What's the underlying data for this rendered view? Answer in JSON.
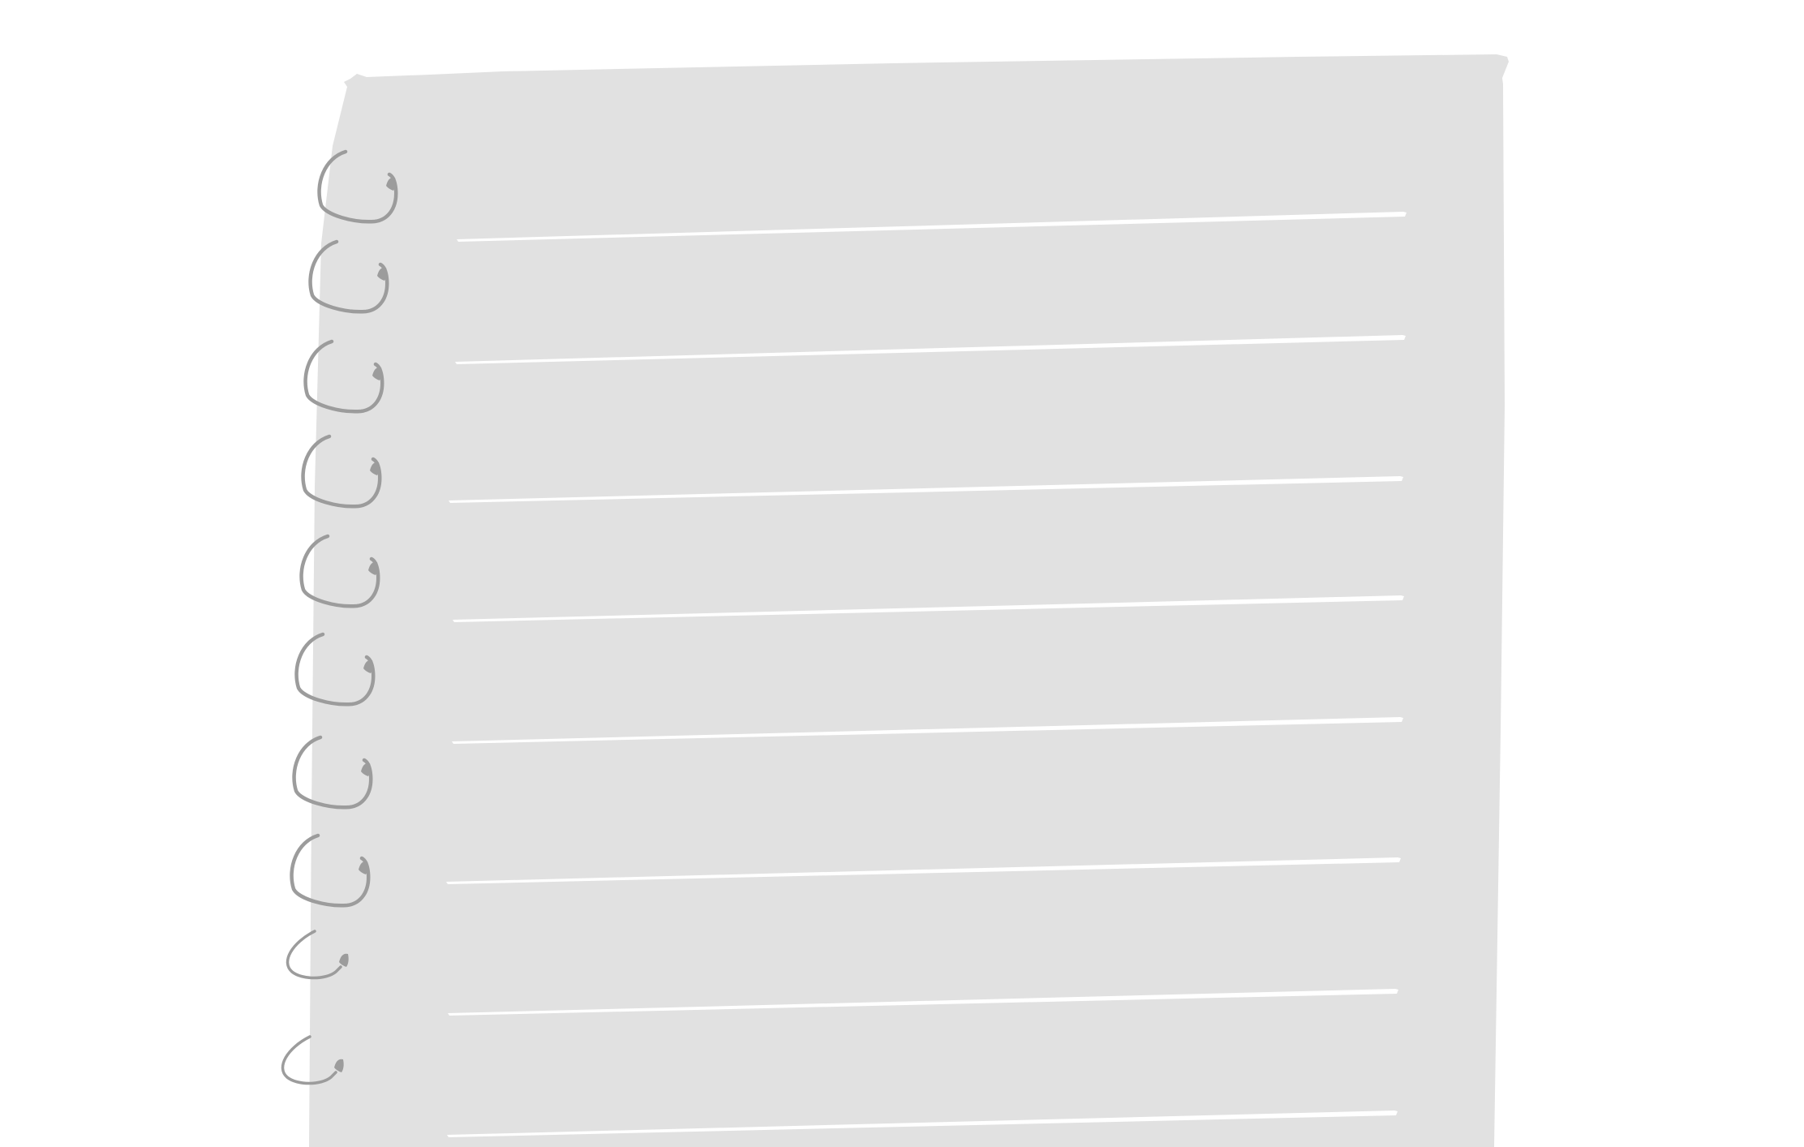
{
  "notepad": {
    "paper_color": "#e1e1e1",
    "rule_line_color": "#ffffff",
    "spiral_ring_color": "#9c9c9c",
    "background_color": "#ffffff",
    "spiral_icon": "spiral-binding-ring-icon",
    "ring_count": 10,
    "rule_line_count": 9,
    "lines": []
  }
}
